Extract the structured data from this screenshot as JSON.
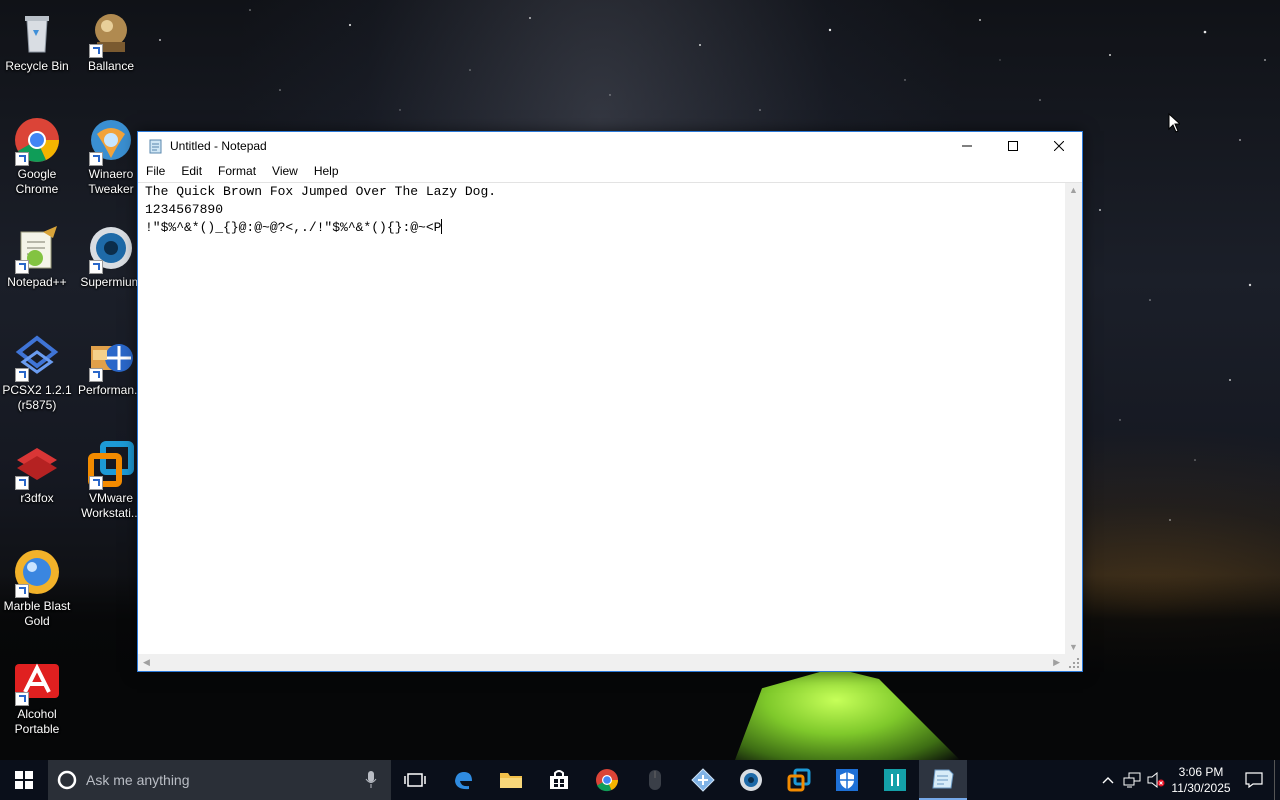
{
  "desktop": {
    "icons": [
      {
        "name": "recycle-bin",
        "label": "Recycle Bin"
      },
      {
        "name": "ballance",
        "label": "Ballance"
      },
      {
        "name": "google-chrome",
        "label": "Google Chrome"
      },
      {
        "name": "winaero-tweaker",
        "label": "Winaero Tweaker"
      },
      {
        "name": "notepad-plus-plus",
        "label": "Notepad++"
      },
      {
        "name": "supermium",
        "label": "Supermium"
      },
      {
        "name": "pcsx2",
        "label": "PCSX2 1.2.1 (r5875)"
      },
      {
        "name": "performance",
        "label": "Performan..."
      },
      {
        "name": "r3dfox",
        "label": "r3dfox"
      },
      {
        "name": "vmware-workstation",
        "label": "VMware Workstati..."
      },
      {
        "name": "marble-blast-gold",
        "label": "Marble Blast Gold"
      },
      {
        "name": "alcohol-portable",
        "label": "Alcohol Portable"
      }
    ]
  },
  "window": {
    "title": "Untitled - Notepad",
    "menu": [
      "File",
      "Edit",
      "Format",
      "View",
      "Help"
    ],
    "content_lines": [
      "The Quick Brown Fox Jumped Over The Lazy Dog.",
      "1234567890",
      "!\"$%^&*()_{}@:@~@?<,./!\"$%^&*(){}:@~<P"
    ]
  },
  "taskbar": {
    "search_placeholder": "Ask me anything",
    "time": "3:06 PM",
    "date": "11/30/2025",
    "pinned": [
      "task-view",
      "edge",
      "file-explorer",
      "store",
      "chrome",
      "mouse-app",
      "remote-app",
      "supermium",
      "vmware",
      "defender",
      "pin-app",
      "notepad"
    ]
  }
}
